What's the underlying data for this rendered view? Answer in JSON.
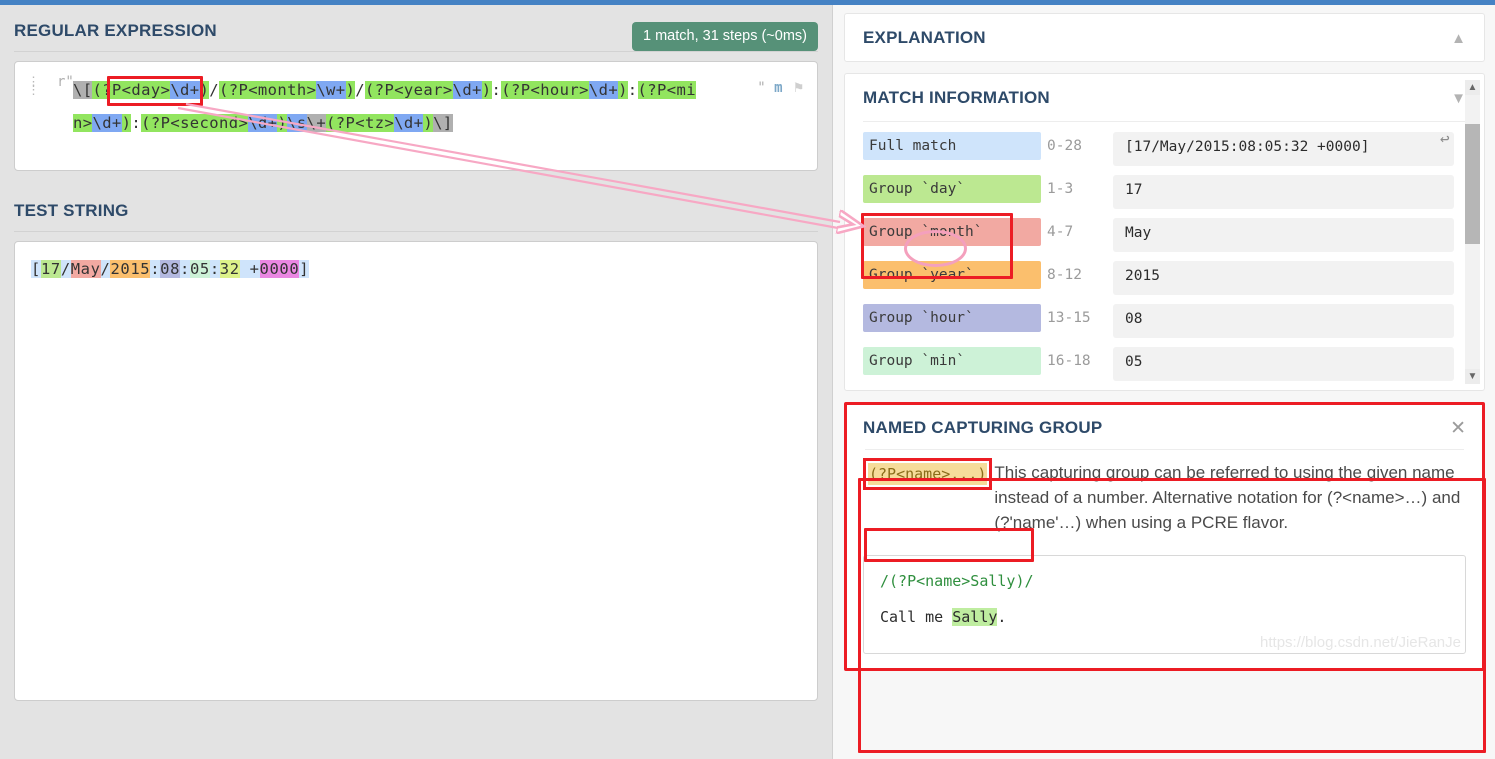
{
  "app": {
    "accent_blue": "#4582c4"
  },
  "left": {
    "regex_section": {
      "title": "REGULAR EXPRESSION",
      "match_badge": "1 match, 31 steps (~0ms)",
      "prefix": "r\"",
      "suffix": "\"",
      "flags": "m",
      "flag_icon": "flag-icon",
      "drag_icon": "drag-handle-icon",
      "pattern_tokens": [
        {
          "t": "\\[",
          "c": "gy"
        },
        {
          "t": "(",
          "c": "g"
        },
        {
          "t": "?P<day>",
          "c": "g"
        },
        {
          "t": "\\d+",
          "c": "b"
        },
        {
          "t": ")",
          "c": "g"
        },
        {
          "t": "/",
          "c": ""
        },
        {
          "t": "(?P<month>",
          "c": "g"
        },
        {
          "t": "\\w+",
          "c": "b"
        },
        {
          "t": ")",
          "c": "g"
        },
        {
          "t": "/",
          "c": ""
        },
        {
          "t": "(?P<year>",
          "c": "g"
        },
        {
          "t": "\\d+",
          "c": "b"
        },
        {
          "t": ")",
          "c": "g"
        },
        {
          "t": ":",
          "c": ""
        },
        {
          "t": "(?P<hour>",
          "c": "g"
        },
        {
          "t": "\\d+",
          "c": "b"
        },
        {
          "t": ")",
          "c": "g"
        },
        {
          "t": ":",
          "c": ""
        },
        {
          "t": "(?P<min>",
          "c": "g"
        },
        {
          "t": "\\d+",
          "c": "b"
        },
        {
          "t": ")",
          "c": "g"
        },
        {
          "t": ":",
          "c": ""
        },
        {
          "t": "(?P<second>",
          "c": "g"
        },
        {
          "t": "\\d+",
          "c": "b"
        },
        {
          "t": ")",
          "c": "g"
        },
        {
          "t": "\\s",
          "c": "b"
        },
        {
          "t": "\\+",
          "c": "gy"
        },
        {
          "t": "(?P<tz>",
          "c": "g"
        },
        {
          "t": "\\d+",
          "c": "b"
        },
        {
          "t": ")",
          "c": "g"
        },
        {
          "t": "\\]",
          "c": "gy"
        }
      ],
      "pattern_plain": "\\[(?P<day>\\d+)/(?P<month>\\w+)/(?P<year>\\d+):(?P<hour>\\d+):(?P<min>\\d+):(?P<second>\\d+)\\s\\+(?P<tz>\\d+)\\]"
    },
    "test_section": {
      "title": "TEST STRING",
      "value_plain": "[17/May/2015:08:05:32 +0000]",
      "tokens": [
        {
          "t": "[",
          "c": "t-full"
        },
        {
          "t": "17",
          "c": "t-day"
        },
        {
          "t": "/",
          "c": "t-full"
        },
        {
          "t": "May",
          "c": "t-month"
        },
        {
          "t": "/",
          "c": "t-full"
        },
        {
          "t": "2015",
          "c": "t-year"
        },
        {
          "t": ":",
          "c": "t-full"
        },
        {
          "t": "08",
          "c": "t-hour"
        },
        {
          "t": ":",
          "c": "t-full"
        },
        {
          "t": "05",
          "c": "t-min"
        },
        {
          "t": ":",
          "c": "t-full"
        },
        {
          "t": "32",
          "c": "t-second"
        },
        {
          "t": " ",
          "c": "t-full"
        },
        {
          "t": "+",
          "c": "t-full"
        },
        {
          "t": "0000",
          "c": "t-tz"
        },
        {
          "t": "]",
          "c": "t-full"
        }
      ]
    }
  },
  "right": {
    "explanation": {
      "title": "EXPLANATION",
      "chevron": "chevron-up-icon"
    },
    "match_information": {
      "title": "MATCH INFORMATION",
      "chevron": "chevron-down-icon",
      "share_icon": "share-icon",
      "rows": [
        {
          "label": "Full match",
          "range": "0-28",
          "value": "[17/May/2015:08:05:32 +0000]",
          "color_class": "l-full",
          "share": true
        },
        {
          "label": "Group `day`",
          "range": "1-3",
          "value": "17",
          "color_class": "l-day",
          "share": false
        },
        {
          "label": "Group `month`",
          "range": "4-7",
          "value": "May",
          "color_class": "l-month",
          "share": false
        },
        {
          "label": "Group `year`",
          "range": "8-12",
          "value": "2015",
          "color_class": "l-year",
          "share": false
        },
        {
          "label": "Group `hour`",
          "range": "13-15",
          "value": "08",
          "color_class": "l-hour",
          "share": false
        },
        {
          "label": "Group `min`",
          "range": "16-18",
          "value": "05",
          "color_class": "l-min",
          "share": false
        }
      ]
    },
    "named_capturing_group": {
      "title": "NAMED CAPTURING GROUP",
      "close_icon": "close-icon",
      "token": "(?P<name>...)",
      "description": "This capturing group can be referred to using the given name instead of a number. Alternative notation for (?<name>…) and (?'name'…) when using a PCRE flavor.",
      "example_regex": "/(?P<name>Sally)/",
      "example_text_before": "Call me ",
      "example_text_highlight": "Sally",
      "example_text_after": "."
    },
    "watermark": "https://blog.csdn.net/JieRanJe"
  },
  "annotations": {
    "red_boxes": [
      "regex-day-token",
      "match-row-day",
      "ncg-card",
      "ncg-token"
    ],
    "ellipse": "day-name-ellipse",
    "arrow": "day-to-group-arrow",
    "color_red": "#ec1c24",
    "color_pink": "#f4a0bd"
  }
}
